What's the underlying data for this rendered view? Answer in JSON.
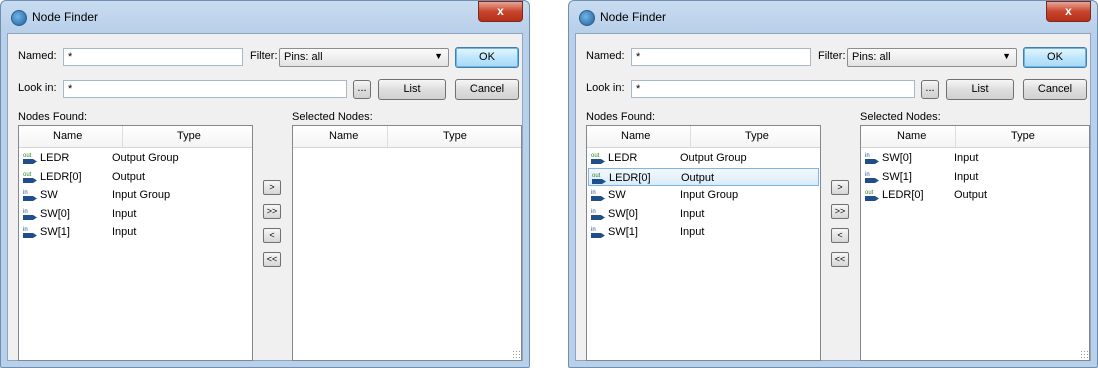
{
  "dialogs": [
    {
      "title": "Node Finder",
      "close": "x",
      "named_label": "Named:",
      "named_value": "*",
      "filter_label": "Filter:",
      "filter_value": "Pins: all",
      "ok": "OK",
      "lookin_label": "Look in:",
      "lookin_value": "*",
      "browse": "...",
      "list": "List",
      "cancel": "Cancel",
      "nodes_found_label": "Nodes Found:",
      "selected_nodes_label": "Selected Nodes:",
      "col_name": "Name",
      "col_type": "Type",
      "move_one": ">",
      "move_all": ">>",
      "remove_one": "<",
      "remove_all": "<<",
      "found": [
        {
          "icon": "out",
          "name": "LEDR",
          "type": "Output Group"
        },
        {
          "icon": "out",
          "name": "LEDR[0]",
          "type": "Output"
        },
        {
          "icon": "in",
          "name": "SW",
          "type": "Input Group"
        },
        {
          "icon": "in",
          "name": "SW[0]",
          "type": "Input"
        },
        {
          "icon": "in",
          "name": "SW[1]",
          "type": "Input"
        }
      ],
      "selected": []
    },
    {
      "title": "Node Finder",
      "close": "x",
      "named_label": "Named:",
      "named_value": "*",
      "filter_label": "Filter:",
      "filter_value": "Pins: all",
      "ok": "OK",
      "lookin_label": "Look in:",
      "lookin_value": "*",
      "browse": "...",
      "list": "List",
      "cancel": "Cancel",
      "nodes_found_label": "Nodes Found:",
      "selected_nodes_label": "Selected Nodes:",
      "col_name": "Name",
      "col_type": "Type",
      "move_one": ">",
      "move_all": ">>",
      "remove_one": "<",
      "remove_all": "<<",
      "found": [
        {
          "icon": "out",
          "name": "LEDR",
          "type": "Output Group"
        },
        {
          "icon": "out",
          "name": "LEDR[0]",
          "type": "Output",
          "highlighted": true
        },
        {
          "icon": "in",
          "name": "SW",
          "type": "Input Group"
        },
        {
          "icon": "in",
          "name": "SW[0]",
          "type": "Input"
        },
        {
          "icon": "in",
          "name": "SW[1]",
          "type": "Input"
        }
      ],
      "selected": [
        {
          "icon": "in",
          "name": "SW[0]",
          "type": "Input"
        },
        {
          "icon": "in",
          "name": "SW[1]",
          "type": "Input"
        },
        {
          "icon": "out",
          "name": "LEDR[0]",
          "type": "Output"
        }
      ]
    }
  ],
  "icon_labels": {
    "out": "out",
    "in": "in"
  },
  "colors": {
    "title_bg": "#b9d0ea",
    "close_red": "#c7452c",
    "pin_blue": "#1f4e8a",
    "pin_green": "#2a8a2a",
    "selection": "#d9ecfb"
  }
}
